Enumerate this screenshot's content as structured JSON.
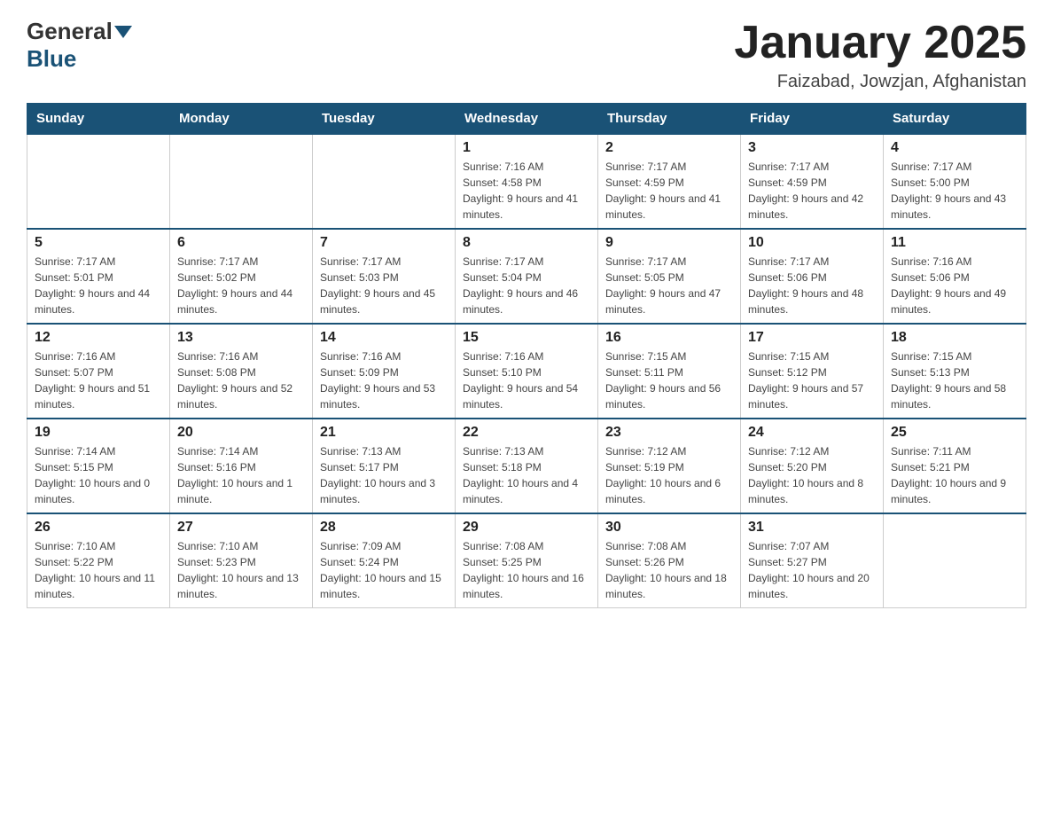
{
  "logo": {
    "general": "General",
    "blue": "Blue"
  },
  "title": "January 2025",
  "location": "Faizabad, Jowzjan, Afghanistan",
  "days_of_week": [
    "Sunday",
    "Monday",
    "Tuesday",
    "Wednesday",
    "Thursday",
    "Friday",
    "Saturday"
  ],
  "weeks": [
    [
      {
        "day": "",
        "info": ""
      },
      {
        "day": "",
        "info": ""
      },
      {
        "day": "",
        "info": ""
      },
      {
        "day": "1",
        "info": "Sunrise: 7:16 AM\nSunset: 4:58 PM\nDaylight: 9 hours and 41 minutes."
      },
      {
        "day": "2",
        "info": "Sunrise: 7:17 AM\nSunset: 4:59 PM\nDaylight: 9 hours and 41 minutes."
      },
      {
        "day": "3",
        "info": "Sunrise: 7:17 AM\nSunset: 4:59 PM\nDaylight: 9 hours and 42 minutes."
      },
      {
        "day": "4",
        "info": "Sunrise: 7:17 AM\nSunset: 5:00 PM\nDaylight: 9 hours and 43 minutes."
      }
    ],
    [
      {
        "day": "5",
        "info": "Sunrise: 7:17 AM\nSunset: 5:01 PM\nDaylight: 9 hours and 44 minutes."
      },
      {
        "day": "6",
        "info": "Sunrise: 7:17 AM\nSunset: 5:02 PM\nDaylight: 9 hours and 44 minutes."
      },
      {
        "day": "7",
        "info": "Sunrise: 7:17 AM\nSunset: 5:03 PM\nDaylight: 9 hours and 45 minutes."
      },
      {
        "day": "8",
        "info": "Sunrise: 7:17 AM\nSunset: 5:04 PM\nDaylight: 9 hours and 46 minutes."
      },
      {
        "day": "9",
        "info": "Sunrise: 7:17 AM\nSunset: 5:05 PM\nDaylight: 9 hours and 47 minutes."
      },
      {
        "day": "10",
        "info": "Sunrise: 7:17 AM\nSunset: 5:06 PM\nDaylight: 9 hours and 48 minutes."
      },
      {
        "day": "11",
        "info": "Sunrise: 7:16 AM\nSunset: 5:06 PM\nDaylight: 9 hours and 49 minutes."
      }
    ],
    [
      {
        "day": "12",
        "info": "Sunrise: 7:16 AM\nSunset: 5:07 PM\nDaylight: 9 hours and 51 minutes."
      },
      {
        "day": "13",
        "info": "Sunrise: 7:16 AM\nSunset: 5:08 PM\nDaylight: 9 hours and 52 minutes."
      },
      {
        "day": "14",
        "info": "Sunrise: 7:16 AM\nSunset: 5:09 PM\nDaylight: 9 hours and 53 minutes."
      },
      {
        "day": "15",
        "info": "Sunrise: 7:16 AM\nSunset: 5:10 PM\nDaylight: 9 hours and 54 minutes."
      },
      {
        "day": "16",
        "info": "Sunrise: 7:15 AM\nSunset: 5:11 PM\nDaylight: 9 hours and 56 minutes."
      },
      {
        "day": "17",
        "info": "Sunrise: 7:15 AM\nSunset: 5:12 PM\nDaylight: 9 hours and 57 minutes."
      },
      {
        "day": "18",
        "info": "Sunrise: 7:15 AM\nSunset: 5:13 PM\nDaylight: 9 hours and 58 minutes."
      }
    ],
    [
      {
        "day": "19",
        "info": "Sunrise: 7:14 AM\nSunset: 5:15 PM\nDaylight: 10 hours and 0 minutes."
      },
      {
        "day": "20",
        "info": "Sunrise: 7:14 AM\nSunset: 5:16 PM\nDaylight: 10 hours and 1 minute."
      },
      {
        "day": "21",
        "info": "Sunrise: 7:13 AM\nSunset: 5:17 PM\nDaylight: 10 hours and 3 minutes."
      },
      {
        "day": "22",
        "info": "Sunrise: 7:13 AM\nSunset: 5:18 PM\nDaylight: 10 hours and 4 minutes."
      },
      {
        "day": "23",
        "info": "Sunrise: 7:12 AM\nSunset: 5:19 PM\nDaylight: 10 hours and 6 minutes."
      },
      {
        "day": "24",
        "info": "Sunrise: 7:12 AM\nSunset: 5:20 PM\nDaylight: 10 hours and 8 minutes."
      },
      {
        "day": "25",
        "info": "Sunrise: 7:11 AM\nSunset: 5:21 PM\nDaylight: 10 hours and 9 minutes."
      }
    ],
    [
      {
        "day": "26",
        "info": "Sunrise: 7:10 AM\nSunset: 5:22 PM\nDaylight: 10 hours and 11 minutes."
      },
      {
        "day": "27",
        "info": "Sunrise: 7:10 AM\nSunset: 5:23 PM\nDaylight: 10 hours and 13 minutes."
      },
      {
        "day": "28",
        "info": "Sunrise: 7:09 AM\nSunset: 5:24 PM\nDaylight: 10 hours and 15 minutes."
      },
      {
        "day": "29",
        "info": "Sunrise: 7:08 AM\nSunset: 5:25 PM\nDaylight: 10 hours and 16 minutes."
      },
      {
        "day": "30",
        "info": "Sunrise: 7:08 AM\nSunset: 5:26 PM\nDaylight: 10 hours and 18 minutes."
      },
      {
        "day": "31",
        "info": "Sunrise: 7:07 AM\nSunset: 5:27 PM\nDaylight: 10 hours and 20 minutes."
      },
      {
        "day": "",
        "info": ""
      }
    ]
  ]
}
